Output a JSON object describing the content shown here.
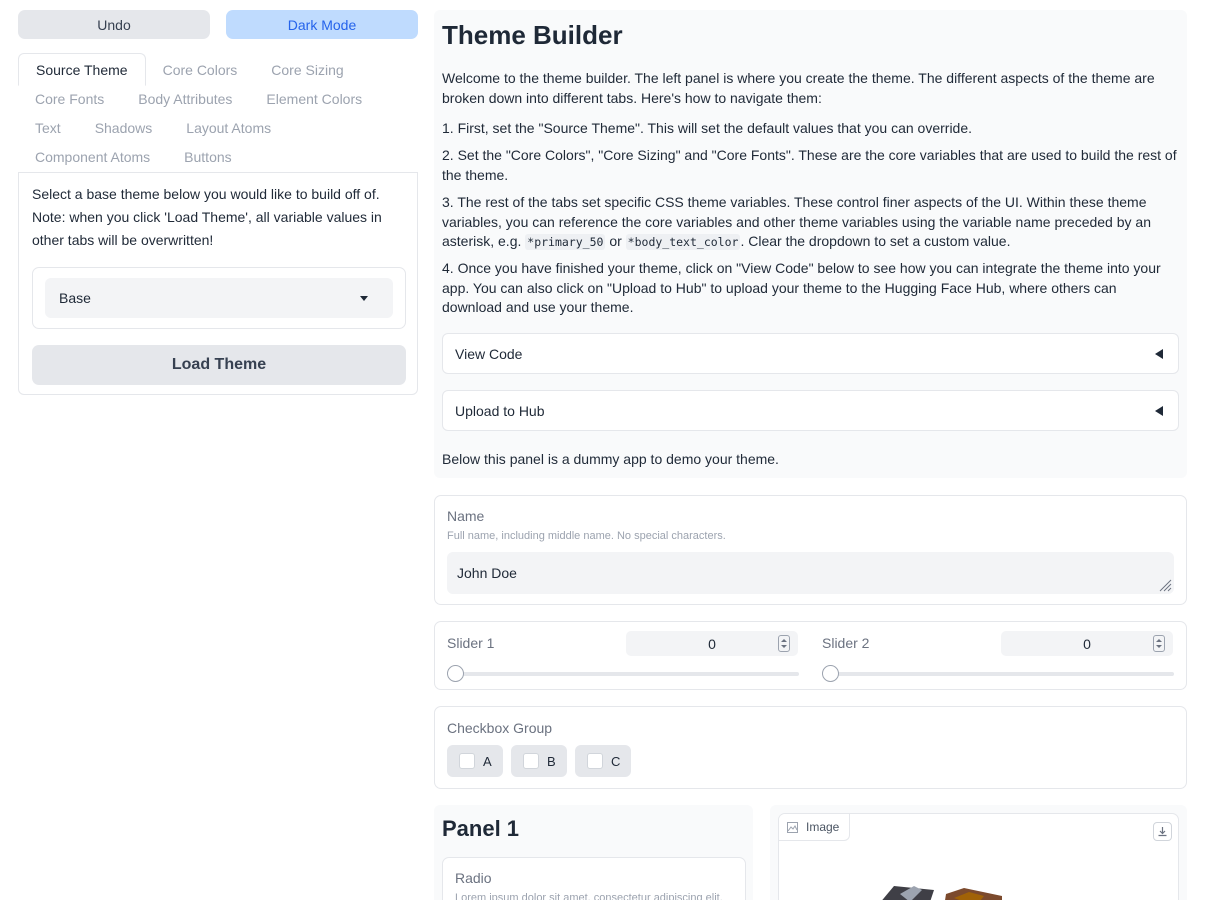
{
  "toolbar": {
    "undo_label": "Undo",
    "dark_mode_label": "Dark Mode"
  },
  "tabs": {
    "row1": [
      "Source Theme",
      "Core Colors",
      "Core Sizing"
    ],
    "row2": [
      "Core Fonts",
      "Body Attributes",
      "Element Colors"
    ],
    "row3": [
      "Text",
      "Shadows",
      "Layout Atoms"
    ],
    "row4": [
      "Component Atoms",
      "Buttons"
    ],
    "active": "Source Theme"
  },
  "source_theme": {
    "description": "Select a base theme below you would like to build off of. Note: when you click 'Load Theme', all variable values in other tabs will be overwritten!",
    "dropdown_value": "Base",
    "load_button": "Load Theme"
  },
  "builder": {
    "title": "Theme Builder",
    "intro": "Welcome to the theme builder. The left panel is where you create the theme. The different aspects of the theme are broken down into different tabs. Here's how to navigate them:",
    "step1": "1. First, set the \"Source Theme\". This will set the default values that you can override.",
    "step2": "2. Set the \"Core Colors\", \"Core Sizing\" and \"Core Fonts\". These are the core variables that are used to build the rest of the theme.",
    "step3_a": "3. The rest of the tabs set specific CSS theme variables. These control finer aspects of the UI. Within these theme variables, you can reference the core variables and other theme variables using the variable name preceded by an asterisk, e.g. ",
    "step3_code1": "*primary_50",
    "step3_or": " or ",
    "step3_code2": "*body_text_color",
    "step3_b": ". Clear the dropdown to set a custom value.",
    "step4": "4. Once you have finished your theme, click on \"View Code\" below to see how you can integrate the theme into your app. You can also click on \"Upload to Hub\" to upload your theme to the Hugging Face Hub, where others can download and use your theme.",
    "view_code": "View Code",
    "upload_hub": "Upload to Hub",
    "footer": "Below this panel is a dummy app to demo your theme."
  },
  "demo": {
    "name_label": "Name",
    "name_info": "Full name, including middle name. No special characters.",
    "name_value": "John Doe",
    "slider1_label": "Slider 1",
    "slider1_value": "0",
    "slider2_label": "Slider 2",
    "slider2_value": "0",
    "checkbox_label": "Checkbox Group",
    "checkboxes": [
      "A",
      "B",
      "C"
    ],
    "panel1_title": "Panel 1",
    "radio_label": "Radio",
    "radio_info": "Lorem ipsum dolor sit amet, consectetur adipiscing elit.",
    "image_label": "Image"
  },
  "colors": {
    "accent": "#2563eb",
    "accent_bg": "#bfdbfe",
    "panel_bg": "#f9fafb",
    "border": "#e5e7eb"
  }
}
